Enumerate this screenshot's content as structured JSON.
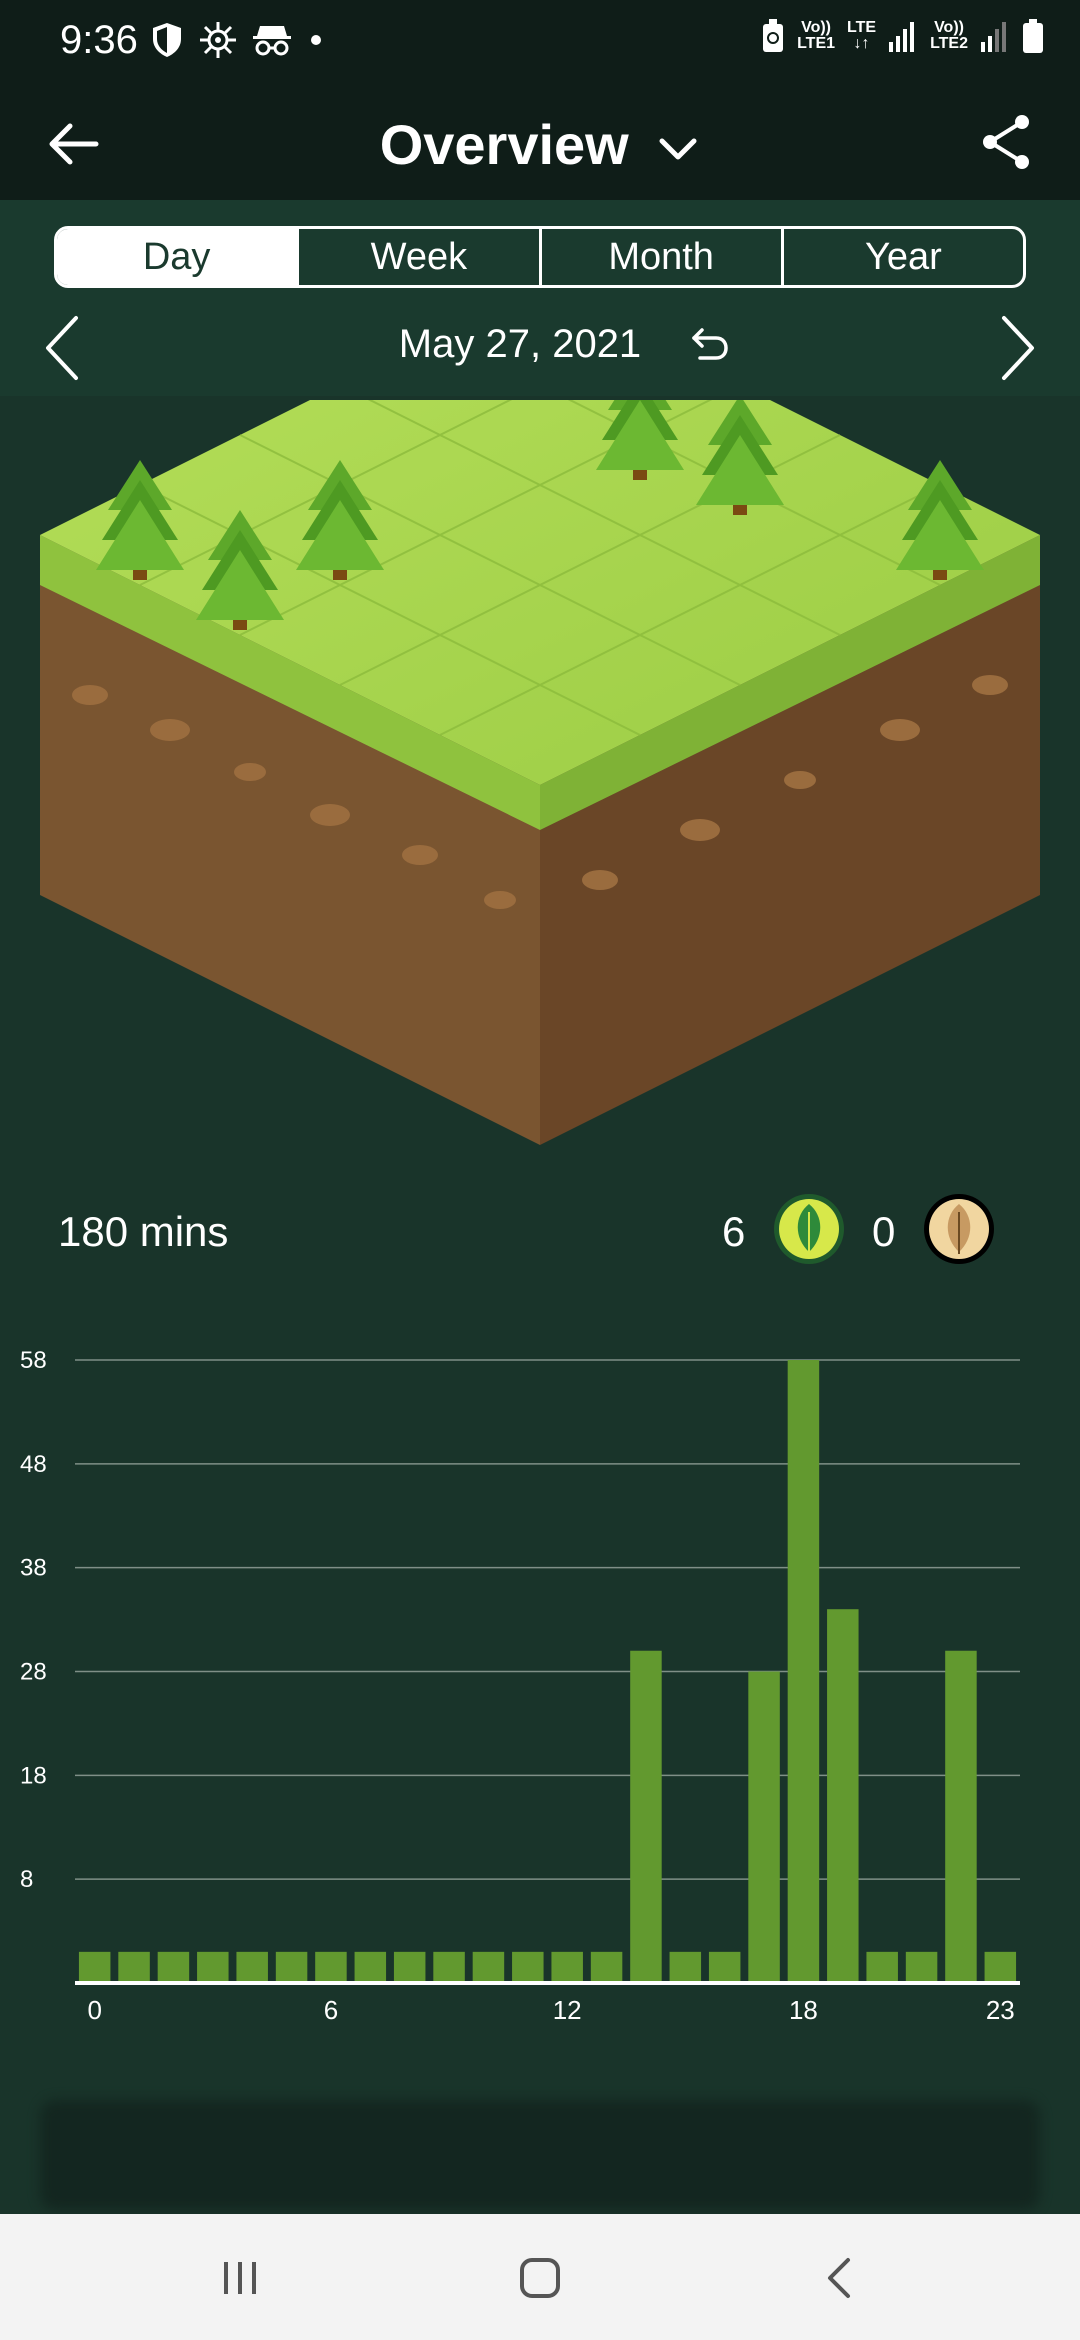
{
  "status_bar": {
    "time": "9:36",
    "sim1_label": "Vo))\nLTE1",
    "data_label": "LTE",
    "sim2_label": "Vo))\nLTE2"
  },
  "app_bar": {
    "title": "Overview",
    "dropdown_icon": "chevron-down-icon",
    "back_icon": "arrow-left-icon",
    "share_icon": "share-icon"
  },
  "tabs": [
    {
      "label": "Day",
      "active": true
    },
    {
      "label": "Week",
      "active": false
    },
    {
      "label": "Month",
      "active": false
    },
    {
      "label": "Year",
      "active": false
    }
  ],
  "date": {
    "text": "May 27, 2021",
    "reset_icon": "undo-icon",
    "prev_icon": "chevron-left-icon",
    "next_icon": "chevron-right-icon"
  },
  "stats": {
    "total": "180 mins",
    "success_count": "6",
    "fail_count": "0"
  },
  "colors": {
    "background": "#19342a",
    "panel": "#1a3a2e",
    "bar": "#62992f",
    "grass": "#a6d44a"
  },
  "chart_data": {
    "type": "bar",
    "x": [
      0,
      1,
      2,
      3,
      4,
      5,
      6,
      7,
      8,
      9,
      10,
      11,
      12,
      13,
      14,
      15,
      16,
      17,
      18,
      19,
      20,
      21,
      22,
      23
    ],
    "values": [
      1,
      1,
      1,
      1,
      1,
      1,
      1,
      1,
      1,
      1,
      1,
      1,
      1,
      1,
      30,
      1,
      1,
      28,
      58,
      34,
      1,
      1,
      30,
      1
    ],
    "x_tick_labels": [
      "0",
      "6",
      "12",
      "18",
      "23"
    ],
    "x_tick_positions": [
      0,
      6,
      12,
      18,
      23
    ],
    "y_ticks": [
      8,
      18,
      28,
      38,
      48,
      58
    ],
    "ylim": [
      -2,
      58
    ],
    "grid": true
  },
  "nav_bar": {
    "recents_icon": "recents-icon",
    "home_icon": "home-icon",
    "back_icon": "nav-back-icon"
  }
}
